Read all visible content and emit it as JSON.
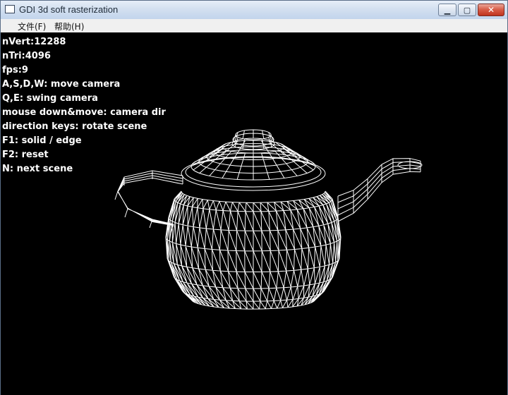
{
  "window": {
    "title": "GDI 3d soft rasterization",
    "controls": {
      "minimize": "▁",
      "maximize": "▢",
      "close": "✕"
    }
  },
  "menu": [
    {
      "label": "文件(F)"
    },
    {
      "label": "帮助(H)"
    }
  ],
  "info_lines": [
    "nVert:12288",
    "nTri:4096",
    "fps:9",
    "A,S,D,W: move camera",
    "Q,E: swing camera",
    "mouse down&move: camera dir",
    "direction keys: rotate scene",
    "F1: solid / edge",
    "F2: reset",
    "N: next scene"
  ],
  "scene": {
    "object": "teapot",
    "render_mode": "edge",
    "background": "#000000",
    "line_color": "#ffffff"
  }
}
